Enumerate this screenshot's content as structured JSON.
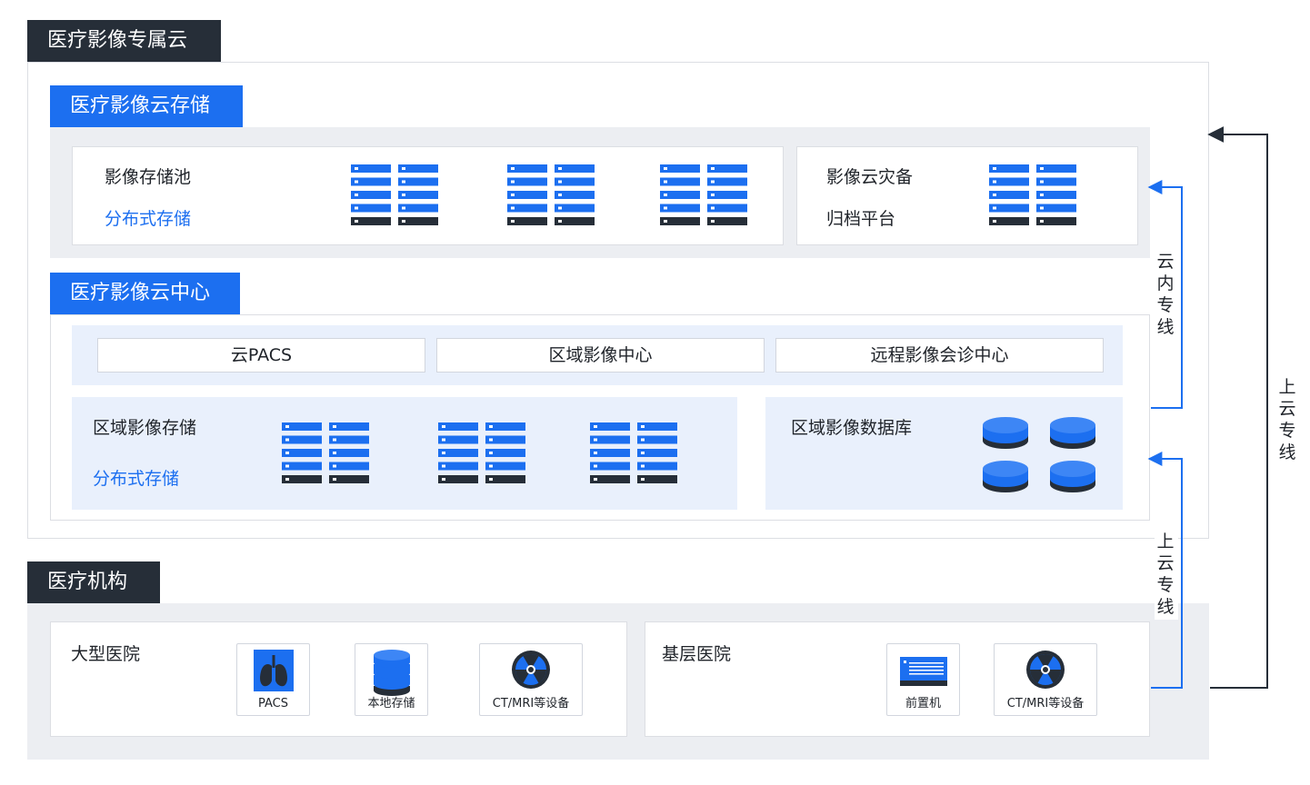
{
  "private_cloud": {
    "title": "医疗影像专属云",
    "storage": {
      "title": "医疗影像云存储",
      "pool": {
        "title": "影像存储池",
        "subtitle": "分布式存储"
      },
      "disaster": {
        "title": "影像云灾备",
        "subtitle": "归档平台"
      }
    },
    "center": {
      "title": "医疗影像云中心",
      "services": [
        "云PACS",
        "区域影像中心",
        "远程影像会诊中心"
      ],
      "regional_storage": {
        "title": "区域影像存储",
        "subtitle": "分布式存储"
      },
      "database": {
        "title": "区域影像数据库"
      }
    }
  },
  "institutions": {
    "title": "医疗机构",
    "large_hospital": {
      "title": "大型医院",
      "devices": [
        {
          "label": "PACS",
          "icon": "lungs-xray-icon"
        },
        {
          "label": "本地存储",
          "icon": "database-icon"
        },
        {
          "label": "CT/MRI等设备",
          "icon": "radiation-icon"
        }
      ]
    },
    "primary_hospital": {
      "title": "基层医院",
      "devices": [
        {
          "label": "前置机",
          "icon": "server-front-icon"
        },
        {
          "label": "CT/MRI等设备",
          "icon": "radiation-icon"
        }
      ]
    }
  },
  "connectors": {
    "intra_cloud": "云内专线",
    "upload_inner": "上云专线",
    "upload_outer": "上云专线"
  },
  "colors": {
    "dark": "#262e38",
    "blue": "#1c6ff0",
    "light_gray": "#eceef2",
    "light_blue": "#e9f0fc"
  }
}
